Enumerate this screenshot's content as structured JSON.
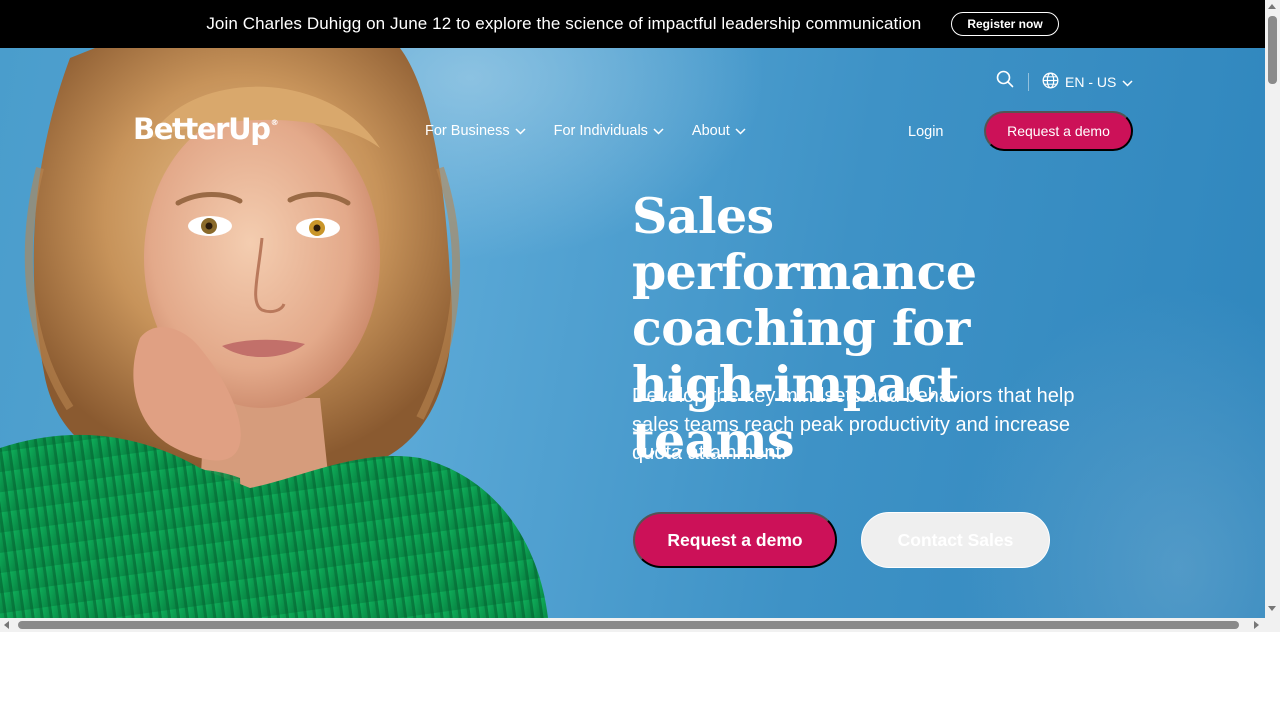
{
  "announcement": {
    "text": "Join Charles Duhigg on June 12 to explore the science of impactful leadership communication",
    "button_label": "Register now"
  },
  "brand": {
    "name": "BetterUp",
    "mark": "®"
  },
  "utility": {
    "search_icon": "search-icon",
    "language_label": "EN - US",
    "globe_icon": "globe-icon"
  },
  "nav": {
    "items": [
      {
        "label": "For Business"
      },
      {
        "label": "For Individuals"
      },
      {
        "label": "About"
      }
    ],
    "login_label": "Login",
    "demo_label": "Request a demo"
  },
  "hero": {
    "headline": "Sales performance coaching for high-impact teams",
    "subcopy": "Develop the key mindsets and behaviors that help sales teams reach peak productivity and increase quota attainment.",
    "primary_cta": "Request a demo",
    "secondary_cta": "Contact Sales",
    "image_description": "Woman with wavy blonde hair in green ribbed sweater resting chin on hand"
  },
  "colors": {
    "accent": "#cc1158",
    "announce_bg": "#000000",
    "hero_bg": "#4a9dcc",
    "sweater": "#0a9a4e"
  }
}
